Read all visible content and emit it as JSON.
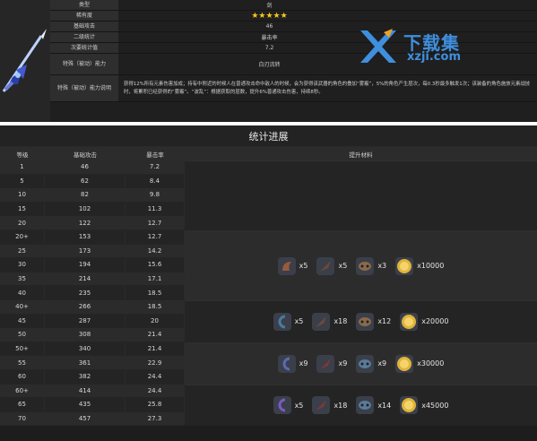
{
  "info": {
    "rows": [
      {
        "label": "类型",
        "value": "剑"
      },
      {
        "label": "稀有度",
        "value": "★★★★★"
      },
      {
        "label": "基础攻击",
        "value": "46"
      },
      {
        "label": "二级统计",
        "value": "暴击率"
      },
      {
        "label": "次要统计值",
        "value": "7.2"
      },
      {
        "label": "特殊（被动）能力",
        "value": "白刃流转"
      },
      {
        "label": "特殊（被动）能力说明",
        "value": "获得12%所有元素伤害加成；持有中附近的时候人在普通攻击命中敌人的时候，会为获得该武器的角色的叠加“雾霰”，5%的角色产生层次，每0.3秒最多触发1次；该装备的角色施放元素战技时，将累积已经获得的“雾霰”。“波乱”：根据获取的层数，提升6%普通攻击伤害，持续8秒。"
      }
    ]
  },
  "watermark": {
    "title": "下载集",
    "url": "xzji.com"
  },
  "ascension": {
    "title": "统计进展",
    "headers": [
      "等级",
      "基础攻击",
      "暴击率",
      "提升材料"
    ],
    "rows": [
      {
        "level": "1",
        "atk": "46",
        "crit": "7.2"
      },
      {
        "level": "5",
        "atk": "62",
        "crit": "8.4"
      },
      {
        "level": "10",
        "atk": "82",
        "crit": "9.8"
      },
      {
        "level": "15",
        "atk": "102",
        "crit": "11.3"
      },
      {
        "level": "20",
        "atk": "122",
        "crit": "12.7"
      },
      {
        "level": "20+",
        "atk": "153",
        "crit": "12.7"
      },
      {
        "level": "25",
        "atk": "173",
        "crit": "14.2"
      },
      {
        "level": "30",
        "atk": "194",
        "crit": "15.6"
      },
      {
        "level": "35",
        "atk": "214",
        "crit": "17.1"
      },
      {
        "level": "40",
        "atk": "235",
        "crit": "18.5"
      },
      {
        "level": "40+",
        "atk": "266",
        "crit": "18.5"
      },
      {
        "level": "45",
        "atk": "287",
        "crit": "20"
      },
      {
        "level": "50",
        "atk": "308",
        "crit": "21.4"
      },
      {
        "level": "50+",
        "atk": "340",
        "crit": "21.4"
      },
      {
        "level": "55",
        "atk": "361",
        "crit": "22.9"
      },
      {
        "level": "60",
        "atk": "382",
        "crit": "24.4"
      },
      {
        "level": "60+",
        "atk": "414",
        "crit": "24.4"
      },
      {
        "level": "65",
        "atk": "435",
        "crit": "25.8"
      },
      {
        "level": "70",
        "atk": "457",
        "crit": "27.3"
      }
    ],
    "materials": [
      {
        "items": [
          {
            "icon": "horn-icon",
            "color": "#9a5a3a",
            "count": "x5"
          },
          {
            "icon": "feather-icon",
            "color": "#6e4a3a",
            "count": "x5"
          },
          {
            "icon": "mask-icon",
            "color": "#8a6a4a",
            "count": "x3"
          },
          {
            "icon": "mora-coin-icon",
            "color": "#e0b33a",
            "count": "x10000"
          }
        ]
      },
      {
        "items": [
          {
            "icon": "orb-icon",
            "color": "#4a7aa0",
            "count": "x5"
          },
          {
            "icon": "feather-icon",
            "color": "#6e4a3a",
            "count": "x18"
          },
          {
            "icon": "mask-icon",
            "color": "#8a6a4a",
            "count": "x12"
          },
          {
            "icon": "mora-coin-icon",
            "color": "#e0b33a",
            "count": "x20000"
          }
        ]
      },
      {
        "items": [
          {
            "icon": "orb-icon",
            "color": "#5a6ab0",
            "count": "x9"
          },
          {
            "icon": "feather-icon",
            "color": "#7a3a3a",
            "count": "x9"
          },
          {
            "icon": "mask-icon",
            "color": "#5a7a9a",
            "count": "x9"
          },
          {
            "icon": "mora-coin-icon",
            "color": "#e0b33a",
            "count": "x30000"
          }
        ]
      },
      {
        "items": [
          {
            "icon": "orb-icon",
            "color": "#7a5ac0",
            "count": "x5"
          },
          {
            "icon": "feather-icon",
            "color": "#7a3a3a",
            "count": "x18"
          },
          {
            "icon": "mask-icon",
            "color": "#5a7a9a",
            "count": "x14"
          },
          {
            "icon": "mora-coin-icon",
            "color": "#e0b33a",
            "count": "x45000"
          }
        ]
      }
    ]
  }
}
